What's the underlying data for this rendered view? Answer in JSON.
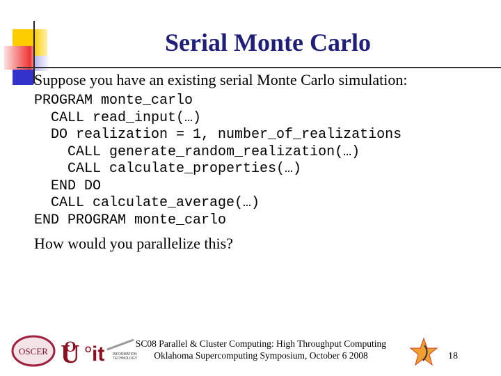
{
  "title": "Serial Monte Carlo",
  "intro": "Suppose you have an existing serial Monte Carlo simulation:",
  "code_lines": [
    "PROGRAM monte_carlo",
    "  CALL read_input(…)",
    "  DO realization = 1, number_of_realizations",
    "    CALL generate_random_realization(…)",
    "    CALL calculate_properties(…)",
    "  END DO",
    "  CALL calculate_average(…)",
    "END PROGRAM monte_carlo"
  ],
  "question": "How would you parallelize this?",
  "footer": {
    "line1": "SC08 Parallel & Cluster Computing: High Throughput Computing",
    "line2": "Oklahoma Supercomputing Symposium, October 6 2008",
    "page_number": "18",
    "logos": [
      "OSCER",
      "OU",
      "IT INFORMATION TECHNOLOGY",
      "OK Supercomputing star"
    ]
  },
  "colors": {
    "title": "#1f1f7a",
    "deco_yellow": "#ffcc00",
    "deco_red": "#ee3333",
    "deco_blue": "#3333cc"
  }
}
